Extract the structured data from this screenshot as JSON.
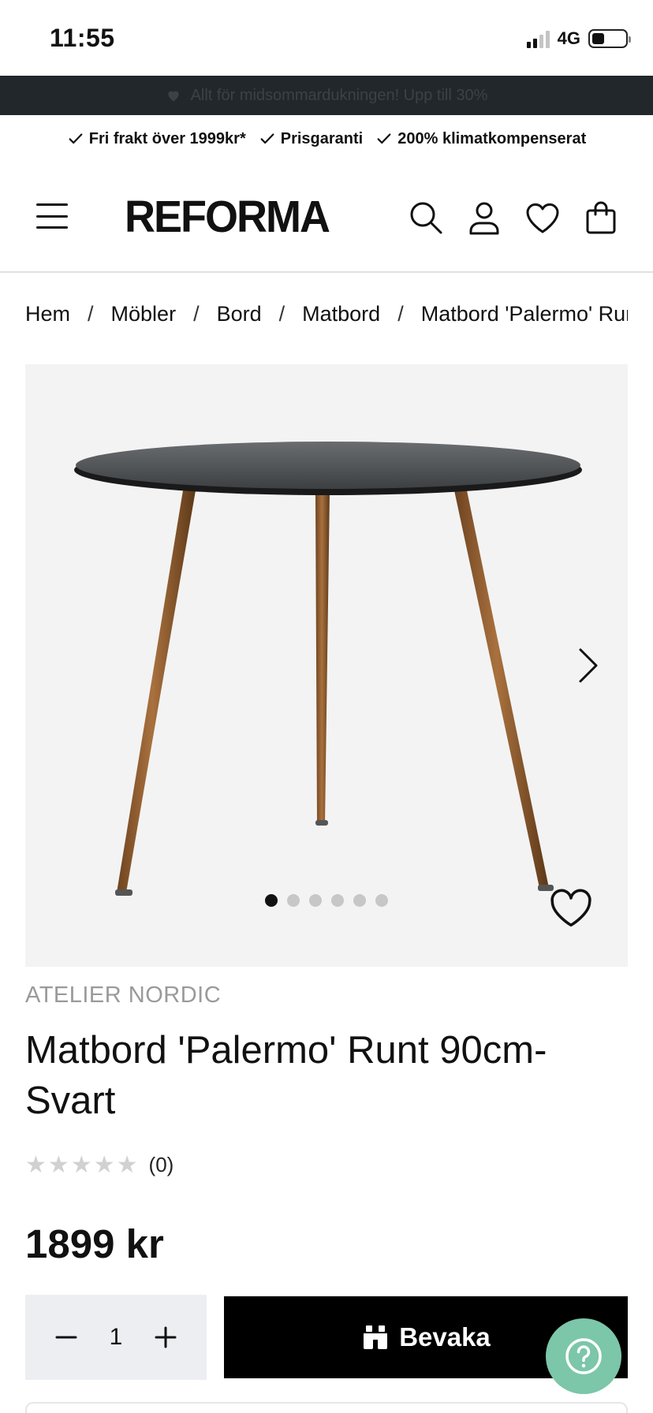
{
  "status_bar": {
    "time": "11:55",
    "network": "4G"
  },
  "promo": {
    "text": "Allt för midsommardukningen! Upp till 30%"
  },
  "usp": [
    {
      "label": "Fri frakt över 1999kr*"
    },
    {
      "label": "Prisgaranti"
    },
    {
      "label": "200% klimatkompenserat"
    }
  ],
  "header": {
    "logo": "REFORMA"
  },
  "breadcrumb": [
    "Hem",
    "Möbler",
    "Bord",
    "Matbord",
    "Matbord 'Palermo' Runt 90cm-Svart"
  ],
  "breadcrumb_separator": "/",
  "gallery": {
    "image_count": 6,
    "active_index": 0
  },
  "product": {
    "brand": "ATELIER NORDIC",
    "title": "Matbord 'Palermo' Runt 90cm-Svart",
    "rating_stars": 0,
    "rating_count": "(0)",
    "price": "1899 kr"
  },
  "purchase": {
    "quantity": "1",
    "minus_label": "−",
    "plus_label": "+",
    "watch_label": "Bevaka"
  },
  "help": {
    "label": "?"
  },
  "colors": {
    "promo_bg": "#22272b",
    "gallery_bg": "#f3f3f3",
    "qty_bg": "#edeef2",
    "button_bg": "#000000",
    "help_bg": "#7cc6a9",
    "brand_text": "#9a9a9a",
    "star_empty": "#d1d1d1"
  },
  "icons": {
    "menu": "hamburger-icon",
    "search": "search-icon",
    "account": "user-icon",
    "wishlist": "heart-icon",
    "cart": "bag-icon",
    "next": "chevron-right-icon",
    "watch": "binoculars-icon",
    "help": "question-icon",
    "usp_check": "check-icon"
  }
}
